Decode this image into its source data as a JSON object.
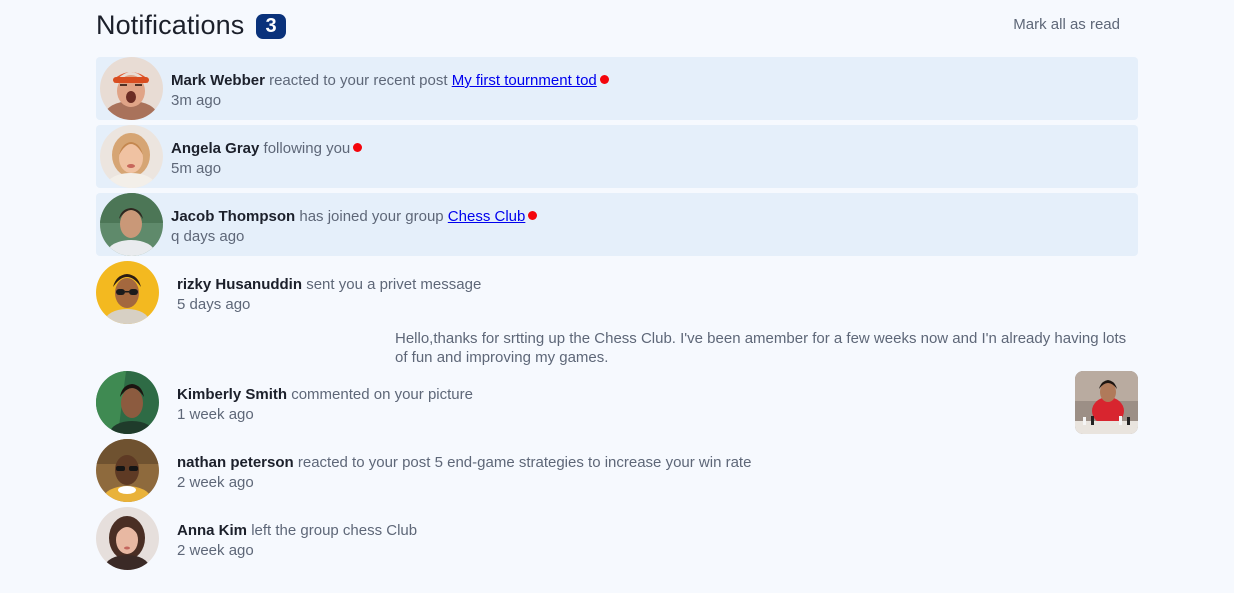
{
  "header": {
    "title": "Notifications",
    "unread_count": "3",
    "mark_all_label": "Mark all as read"
  },
  "notifications": [
    {
      "name": "Mark Webber",
      "action": "reacted to your recent post",
      "link": "My first tournment tod",
      "time": "3m ago",
      "unread": true,
      "avatar_icon": "avatar-mark-webber"
    },
    {
      "name": "Angela Gray",
      "action": "following you",
      "time": "5m ago",
      "unread": true,
      "avatar_icon": "avatar-angela-gray"
    },
    {
      "name": "Jacob Thompson",
      "action": "has joined your group",
      "link": "Chess Club",
      "time": "q days ago",
      "unread": true,
      "avatar_icon": "avatar-jacob-thompson"
    },
    {
      "name": "rizky Husanuddin",
      "action": "sent you a privet message",
      "time": "5 days ago",
      "unread": false,
      "message": "Hello,thanks for srtting up the Chess Club. I've been amember for a few weeks now and I'n already having lots of fun and improving my games.",
      "avatar_icon": "avatar-rizky-husanuddin"
    },
    {
      "name": "Kimberly Smith",
      "action": "commented on your picture",
      "time": "1 week ago",
      "unread": false,
      "picture_icon": "chess-picture-thumbnail",
      "avatar_icon": "avatar-kimberly-smith"
    },
    {
      "name": "nathan peterson",
      "action": "reacted to your post 5 end-game strategies to increase your win rate",
      "time": "2 week ago",
      "unread": false,
      "avatar_icon": "avatar-nathan-peterson"
    },
    {
      "name": "Anna Kim",
      "action": "left the group chess Club",
      "time": "2 week ago",
      "unread": false,
      "avatar_icon": "avatar-anna-kim"
    }
  ],
  "colors": {
    "background": "#f6f9fe",
    "unread_background": "#e5effa",
    "badge": "#0a327b",
    "dot": "#f4050c",
    "text_dark": "#1c202b",
    "text_muted": "#5e6778",
    "link": "#0000ee"
  }
}
